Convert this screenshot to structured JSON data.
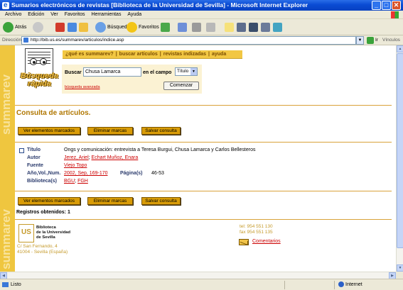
{
  "window": {
    "title": "Sumarios electrónicos de revistas [Biblioteca de la Universidad de Sevilla] - Microsoft Internet Explorer"
  },
  "menu": [
    "Archivo",
    "Edición",
    "Ver",
    "Favoritos",
    "Herramientas",
    "Ayuda"
  ],
  "toolbar": {
    "back": "Atrás",
    "search": "Búsqueda",
    "favorites": "Favoritos"
  },
  "address": {
    "label": "Dirección",
    "url": "http://bib.us.es/summarev/articulos/indice.asp",
    "go": "Ir",
    "links": "Vínculos"
  },
  "sidebar": {
    "text": "summarev"
  },
  "logo": {
    "line1": "Búsqueda",
    "line2": "rápida"
  },
  "nav": {
    "item1": "¿qué es summarev?",
    "item2": "buscar artículos",
    "item3": "revistas indizadas",
    "item4": "ayuda"
  },
  "search": {
    "label": "Buscar",
    "value": "Chusa Lamarca",
    "field_label": "en el campo",
    "field_value": "Título",
    "advanced": "búsqueda avanzada",
    "submit": "Comenzar"
  },
  "page": {
    "title": "Consulta de artículos.",
    "results_label": "Registros obtenidos: 1"
  },
  "actions": {
    "view": "Ver elementos marcados",
    "delete": "Eliminar marcas",
    "save": "Salvar consulta"
  },
  "record": {
    "labels": {
      "title": "Título",
      "author": "Autor",
      "source": "Fuente",
      "year": "Año,Vol.,Num.",
      "pages": "Página(s)",
      "library": "Biblioteca(s)"
    },
    "title": "Ongs y comunicación: entrevista a Teresa Burgui, Chusa Lamarca y Carlos Bellesteros",
    "authors": [
      "Jerez, Ariel",
      "Echart Muñoz, Enara"
    ],
    "author_sep": ";",
    "source": "Viejo Topo",
    "year": "2002, Sep, 169-170",
    "pages": "46-53",
    "libraries": [
      "BGU",
      "FGH"
    ]
  },
  "footer": {
    "org": [
      "Biblioteca",
      "de la Universidad",
      "de Sevilla"
    ],
    "address": [
      "C/ San Fernando, 4",
      "41004 - Sevilla (España)"
    ],
    "tel": "tel: 954 551 130",
    "fax": "fax 954 551 135",
    "comments": "Comentarios"
  },
  "status": {
    "left": "Listo",
    "zone": "Internet"
  }
}
